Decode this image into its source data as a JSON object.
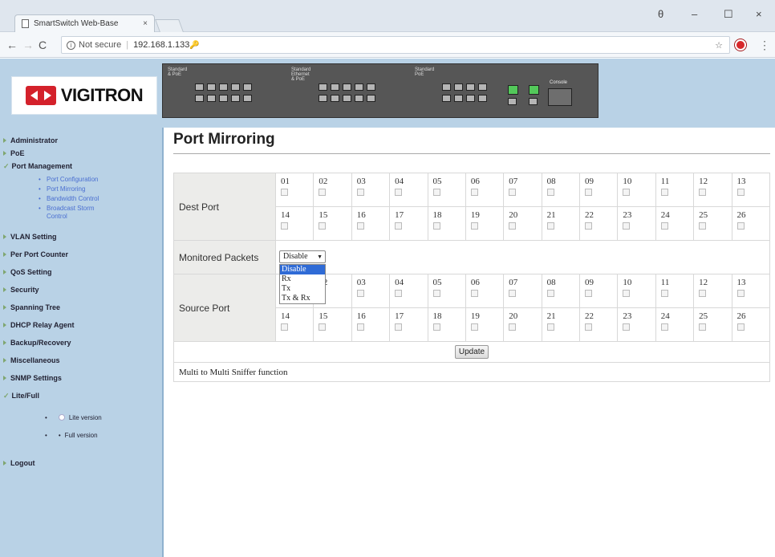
{
  "browser": {
    "tab_title": "SmartSwitch Web-Base",
    "tab_close": "×",
    "not_secure": "Not secure",
    "url": "192.168.1.133",
    "back": "←",
    "forward": "→",
    "reload": "C",
    "star": "☆",
    "window_controls": [
      "θ",
      "–",
      "☐",
      "×"
    ]
  },
  "header": {
    "logo_text": "VIGITRON",
    "device": {
      "group1_label": "Standard & PoE",
      "group2_label": "Standard Ethernet & PoE",
      "group3_label": "Standard PoE",
      "console_label": "Console"
    }
  },
  "sidebar": {
    "items": [
      {
        "label": "Administrator",
        "expanded": false
      },
      {
        "label": "PoE",
        "expanded": false
      },
      {
        "label": "Port Management",
        "expanded": true
      }
    ],
    "port_management_sub": [
      "Port Configuration",
      "Port Mirroring",
      "Bandwidth Control",
      "Broadcast Storm Control"
    ],
    "items2": [
      {
        "label": "VLAN Setting"
      },
      {
        "label": "Per Port Counter"
      },
      {
        "label": "QoS Setting"
      },
      {
        "label": "Security"
      },
      {
        "label": "Spanning Tree"
      },
      {
        "label": "DHCP Relay Agent"
      },
      {
        "label": "Backup/Recovery"
      },
      {
        "label": "Miscellaneous"
      },
      {
        "label": "SNMP Settings"
      },
      {
        "label": "Lite/Full"
      }
    ],
    "lite_full_options": [
      "Lite version",
      "Full version"
    ],
    "logout": "Logout"
  },
  "main": {
    "title": "Port Mirroring",
    "dest_label": "Dest Port",
    "monitored_label": "Monitored Packets",
    "source_label": "Source Port",
    "ports_row1": [
      "01",
      "02",
      "03",
      "04",
      "05",
      "06",
      "07",
      "08",
      "09",
      "10",
      "11",
      "12",
      "13"
    ],
    "ports_row2": [
      "14",
      "15",
      "16",
      "17",
      "18",
      "19",
      "20",
      "21",
      "22",
      "23",
      "24",
      "25",
      "26"
    ],
    "monitored_select": {
      "value": "Disable",
      "options": [
        "Disable",
        "Rx",
        "Tx",
        "Tx & Rx"
      ],
      "highlighted": "Disable"
    },
    "update_label": "Update",
    "note": "Multi to Multi Sniffer function"
  },
  "colors": {
    "sidebar_bg": "#b9d2e6",
    "link": "#4a6fd1",
    "label_cell": "#ececea",
    "logo_red": "#d4212b",
    "port_active": "#53c85a"
  }
}
